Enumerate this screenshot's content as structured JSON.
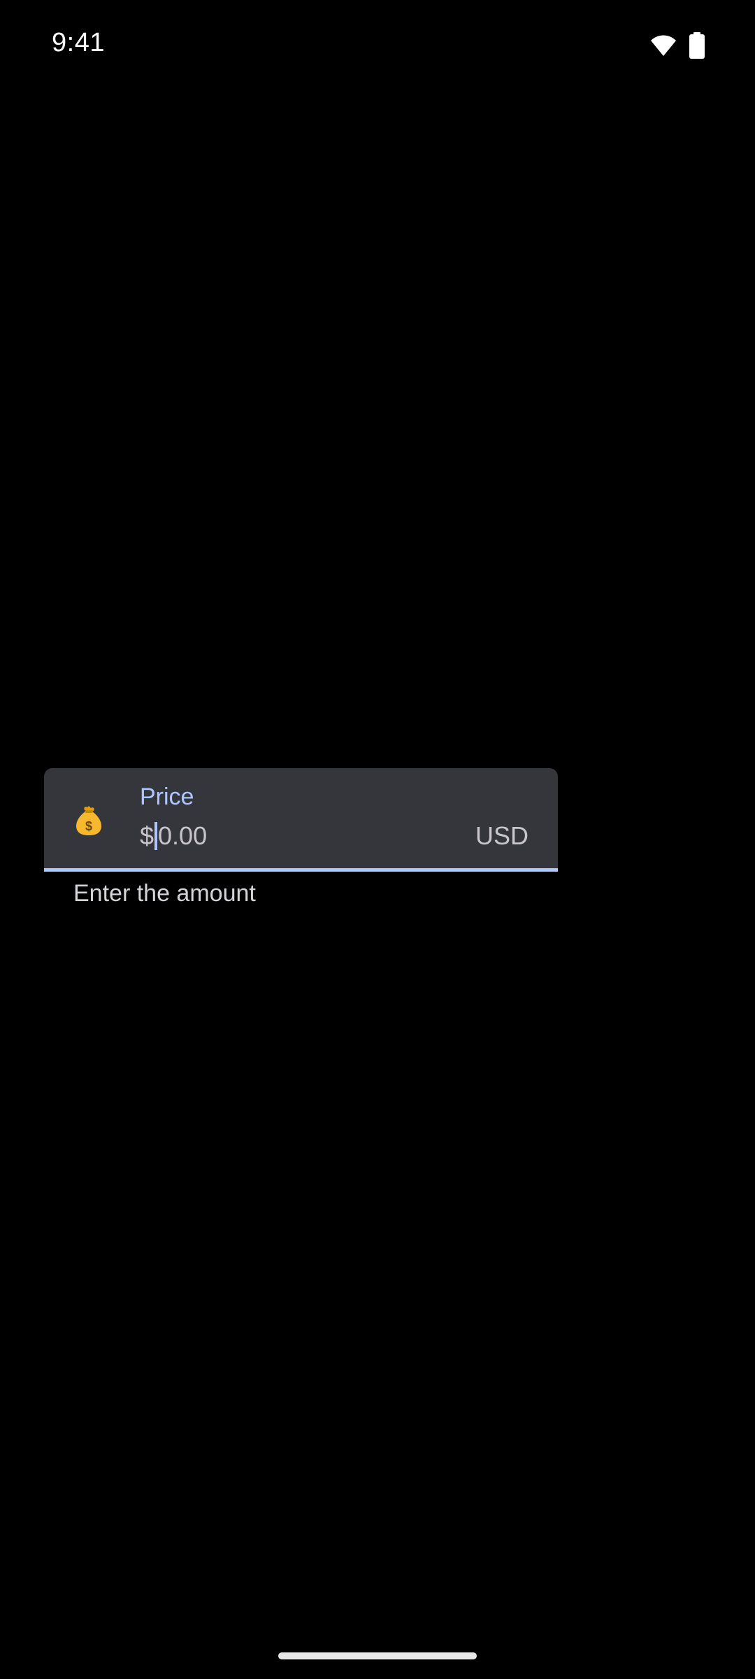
{
  "status_bar": {
    "time": "9:41",
    "wifi_icon": "wifi-icon",
    "battery_icon": "battery-icon"
  },
  "price_field": {
    "label": "Price",
    "prefix": "$",
    "value": "",
    "placeholder": "0.00",
    "suffix": "USD",
    "leading_icon": "money-bag-icon",
    "supporting_text": "Enter the amount",
    "accent_color": "#aec6ff",
    "container_color": "#35363c"
  },
  "colors": {
    "background": "#000000"
  }
}
